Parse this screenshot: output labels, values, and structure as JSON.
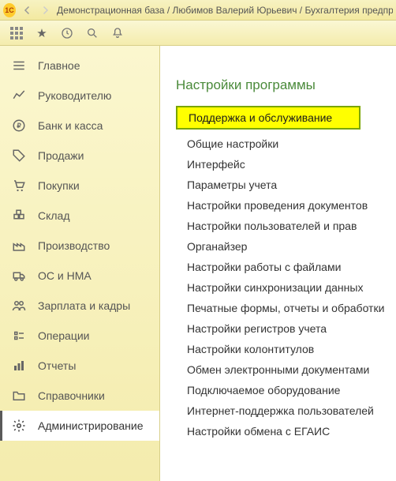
{
  "title": {
    "text": "Демонстрационная база / Любимов Валерий Юрьевич / Бухгалтерия предприятия, ре"
  },
  "toolbar": {
    "apps": "apps",
    "star": "star",
    "history": "history",
    "search": "search",
    "bell": "bell"
  },
  "sidebar": {
    "items": [
      {
        "label": "Главное"
      },
      {
        "label": "Руководителю"
      },
      {
        "label": "Банк и касса"
      },
      {
        "label": "Продажи"
      },
      {
        "label": "Покупки"
      },
      {
        "label": "Склад"
      },
      {
        "label": "Производство"
      },
      {
        "label": "ОС и НМА"
      },
      {
        "label": "Зарплата и кадры"
      },
      {
        "label": "Операции"
      },
      {
        "label": "Отчеты"
      },
      {
        "label": "Справочники"
      },
      {
        "label": "Администрирование"
      }
    ]
  },
  "content": {
    "page_title": "Настройки программы",
    "links": [
      "Поддержка и обслуживание",
      "Общие настройки",
      "Интерфейс",
      "Параметры учета",
      "Настройки проведения документов",
      "Настройки пользователей и прав",
      "Органайзер",
      "Настройки работы с файлами",
      "Настройки синхронизации данных",
      "Печатные формы, отчеты и обработки",
      "Настройки регистров учета",
      "Настройки колонтитулов",
      "Обмен электронными документами",
      "Подключаемое оборудование",
      "Интернет-поддержка пользователей",
      "Настройки обмена с ЕГАИС"
    ]
  }
}
